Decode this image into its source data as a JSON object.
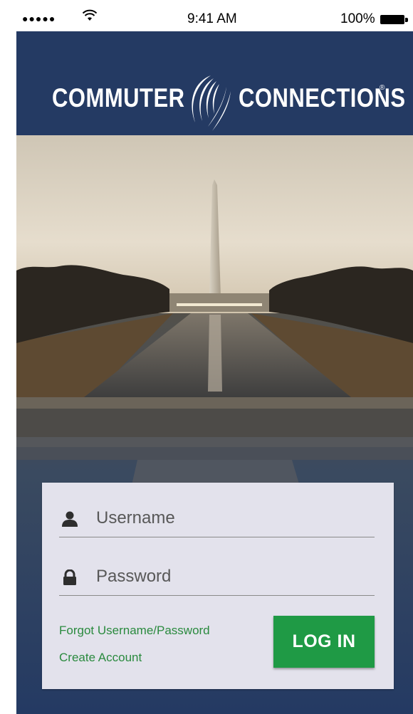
{
  "status_bar": {
    "signal": "●●●●●",
    "wifi_icon": "wifi-icon",
    "time": "9:41 AM",
    "battery_percent": "100%",
    "battery_icon": "battery-full-icon"
  },
  "header": {
    "logo_left": "COMMUTER",
    "logo_right": "CONNECTIONS",
    "logo_reg": "®",
    "background_color": "#243a63"
  },
  "hero": {
    "image_subject": "washington-monument-reflecting-pool-photo"
  },
  "login": {
    "username_placeholder": "Username",
    "username_value": "",
    "username_icon": "user-icon",
    "password_placeholder": "Password",
    "password_value": "",
    "password_icon": "lock-icon",
    "forgot_link": "Forgot Username/Password",
    "create_link": "Create Account",
    "login_button": "LOG IN",
    "accent_color": "#1f9a45",
    "link_color": "#2a8a3e"
  }
}
